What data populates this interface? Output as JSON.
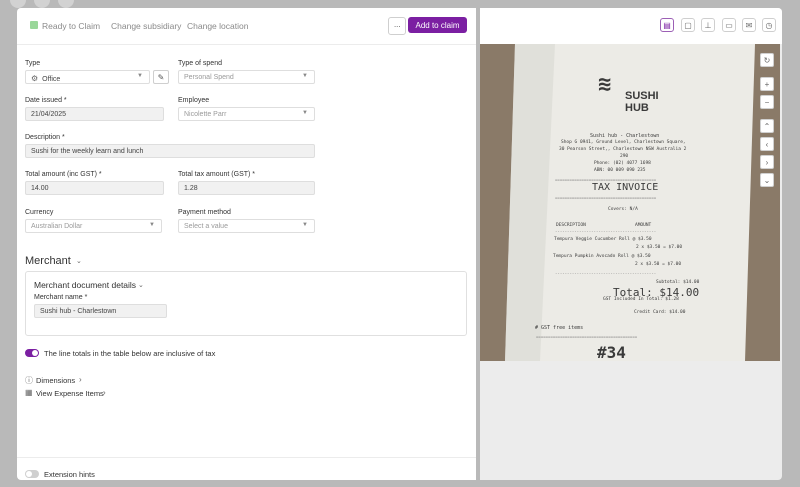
{
  "toolbar": {
    "status": "Ready to Claim",
    "change_subsidiary": "Change subsidiary",
    "change_location": "Change location",
    "more": "···",
    "add_to_claim": "Add to claim"
  },
  "form": {
    "type": {
      "label": "Type",
      "value": "Office"
    },
    "type_of_spend": {
      "label": "Type of spend",
      "value": "Personal Spend"
    },
    "date_issued": {
      "label": "Date issued *",
      "value": "21/04/2025"
    },
    "employee": {
      "label": "Employee",
      "value": "Nicolette Parr"
    },
    "description": {
      "label": "Description *",
      "value": "Sushi for the weekly learn and lunch"
    },
    "total_amount": {
      "label": "Total amount (inc GST) *",
      "value": "14.00"
    },
    "total_tax": {
      "label": "Total tax amount (GST) *",
      "value": "1.28"
    },
    "currency": {
      "label": "Currency",
      "value": "Australian Dollar"
    },
    "payment_method": {
      "label": "Payment method",
      "placeholder": "Select a value"
    }
  },
  "merchant": {
    "section_title": "Merchant",
    "doc_details_title": "Merchant document details",
    "name_label": "Merchant name *",
    "name_value": "Sushi hub - Charlestown"
  },
  "toggles": {
    "inclusive_tax_label": "The line totals in the table below are inclusive of tax",
    "extension_hints_label": "Extension hints"
  },
  "links": {
    "dimensions": "Dimensions",
    "view_expense_items": "View Expense Items"
  },
  "receipt": {
    "brand_line1": "SUSHI",
    "brand_line2": "HUB",
    "line_store": "Sushi hub - Charlestown",
    "line_addr1": "Shop G 0941, Ground Level, Charlestown Square,",
    "line_addr2": "30 Pearson Street,, Charlestown  NSW Australia 2",
    "line_addr3": "290",
    "line_phone": "Phone: (02) 4077 1698",
    "line_abn": "ABN: 00 009 090 235",
    "tax_invoice": "TAX INVOICE",
    "covers": "Covers: N/A",
    "col_desc": "DESCRIPTION",
    "col_amount": "AMOUNT",
    "item1": "Tempura Veggie Cucumber Roll @ $3.50",
    "item1_qty": "2 x   $3.50 = $7.00",
    "item2": "Tempura Pumpkin Avocado Roll @ $3.50",
    "item2_qty": "2 x   $3.50 = $7.00",
    "subtotal": "Subtotal: $14.00",
    "total": "Total: $14.00",
    "gst_included": "GST Included In Total: $1.28",
    "credit_card": "Credit Card: $14.00",
    "gst_free": "# GST free items",
    "order_no": "#34"
  },
  "icons": {
    "status": "status-square-icon",
    "type": "gear-icon",
    "edit": "pencil-icon",
    "dimensions": "info-circle-icon",
    "expense_items": "table-icon"
  },
  "colors": {
    "accent": "#7b1fa2",
    "status_green": "#9ad79a",
    "toggle_off": "#cfcfcf"
  }
}
